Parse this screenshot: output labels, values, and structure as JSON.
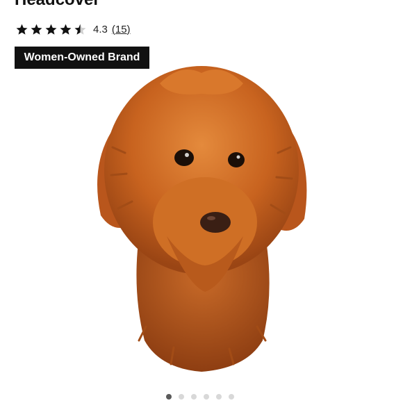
{
  "product": {
    "title_fragment": "Headcover",
    "rating": {
      "stars": 4.3,
      "max": 5,
      "value_label": "4.3",
      "count_label": "(15)"
    },
    "badge_label": "Women-Owned Brand",
    "image_icon": "plush-dog-headcover-image"
  },
  "carousel": {
    "total_slides": 6,
    "active_index": 0
  },
  "colors": {
    "star": "#111111",
    "star_empty": "#cfcfcf",
    "badge_bg": "#111111",
    "badge_text": "#ffffff",
    "fur": "#c8631f",
    "dot_active": "#5a5a5a",
    "dot_inactive": "#d8d8d8"
  }
}
